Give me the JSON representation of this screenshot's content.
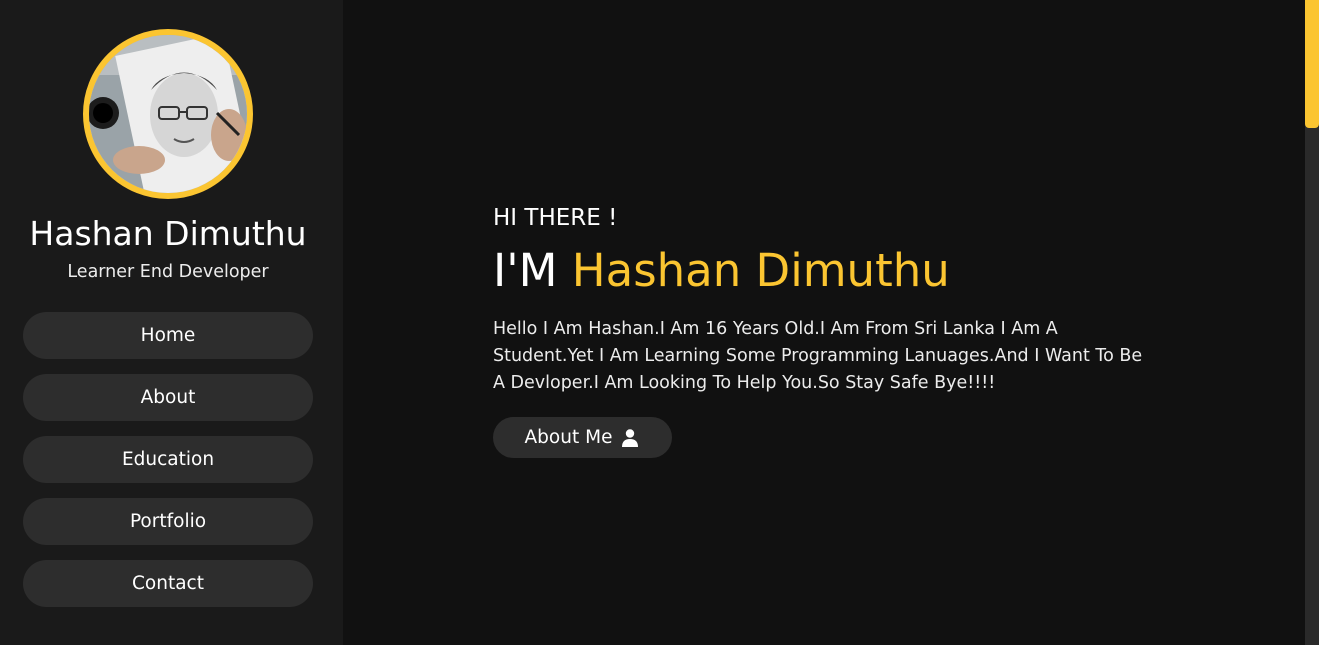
{
  "sidebar": {
    "name": "Hashan Dimuthu",
    "role": "Learner End Developer",
    "nav": [
      {
        "label": "Home"
      },
      {
        "label": "About"
      },
      {
        "label": "Education"
      },
      {
        "label": "Portfolio"
      },
      {
        "label": "Contact"
      }
    ]
  },
  "hero": {
    "greeting": "HI THERE !",
    "headline_prefix": "I'M",
    "headline_name": "Hashan Dimuthu",
    "bio": "Hello I Am Hashan.I Am 16 Years Old.I Am From Sri Lanka I Am A Student.Yet I Am Learning Some Programming Lanuages.And I Want To Be A Devloper.I Am Looking To Help You.So Stay Safe Bye!!!!",
    "button_label": "About Me",
    "button_icon": "user-icon"
  },
  "colors": {
    "accent": "#fbc531",
    "sidebar_bg": "#1a1a1a",
    "page_bg": "#111111",
    "button_bg": "#2d2d2d"
  }
}
